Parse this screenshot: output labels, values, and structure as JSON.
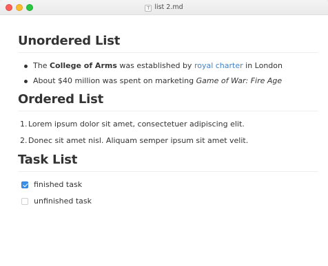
{
  "window": {
    "title": "list 2.md",
    "doc_icon": "T"
  },
  "sections": {
    "unordered": {
      "heading": "Unordered List",
      "items": [
        {
          "pre": "The ",
          "bold": "College of Arms",
          "mid": " was established by ",
          "link": "royal charter",
          "post": " in London"
        },
        {
          "pre": "About $40 million was spent on marketing ",
          "italic": "Game of War: Fire Age"
        }
      ]
    },
    "ordered": {
      "heading": "Ordered List",
      "items": [
        {
          "num": "1.",
          "text": "Lorem ipsum dolor sit amet, consectetuer adipiscing elit."
        },
        {
          "num": "2.",
          "text": "Donec sit amet nisl. Aliquam semper ipsum sit amet velit."
        }
      ]
    },
    "tasks": {
      "heading": "Task List",
      "items": [
        {
          "text": "finished task",
          "checked": true
        },
        {
          "text": "unfinished task",
          "checked": false
        }
      ]
    }
  },
  "colors": {
    "link": "#4183c4",
    "checkbox_checked": "#3b8fe8"
  }
}
